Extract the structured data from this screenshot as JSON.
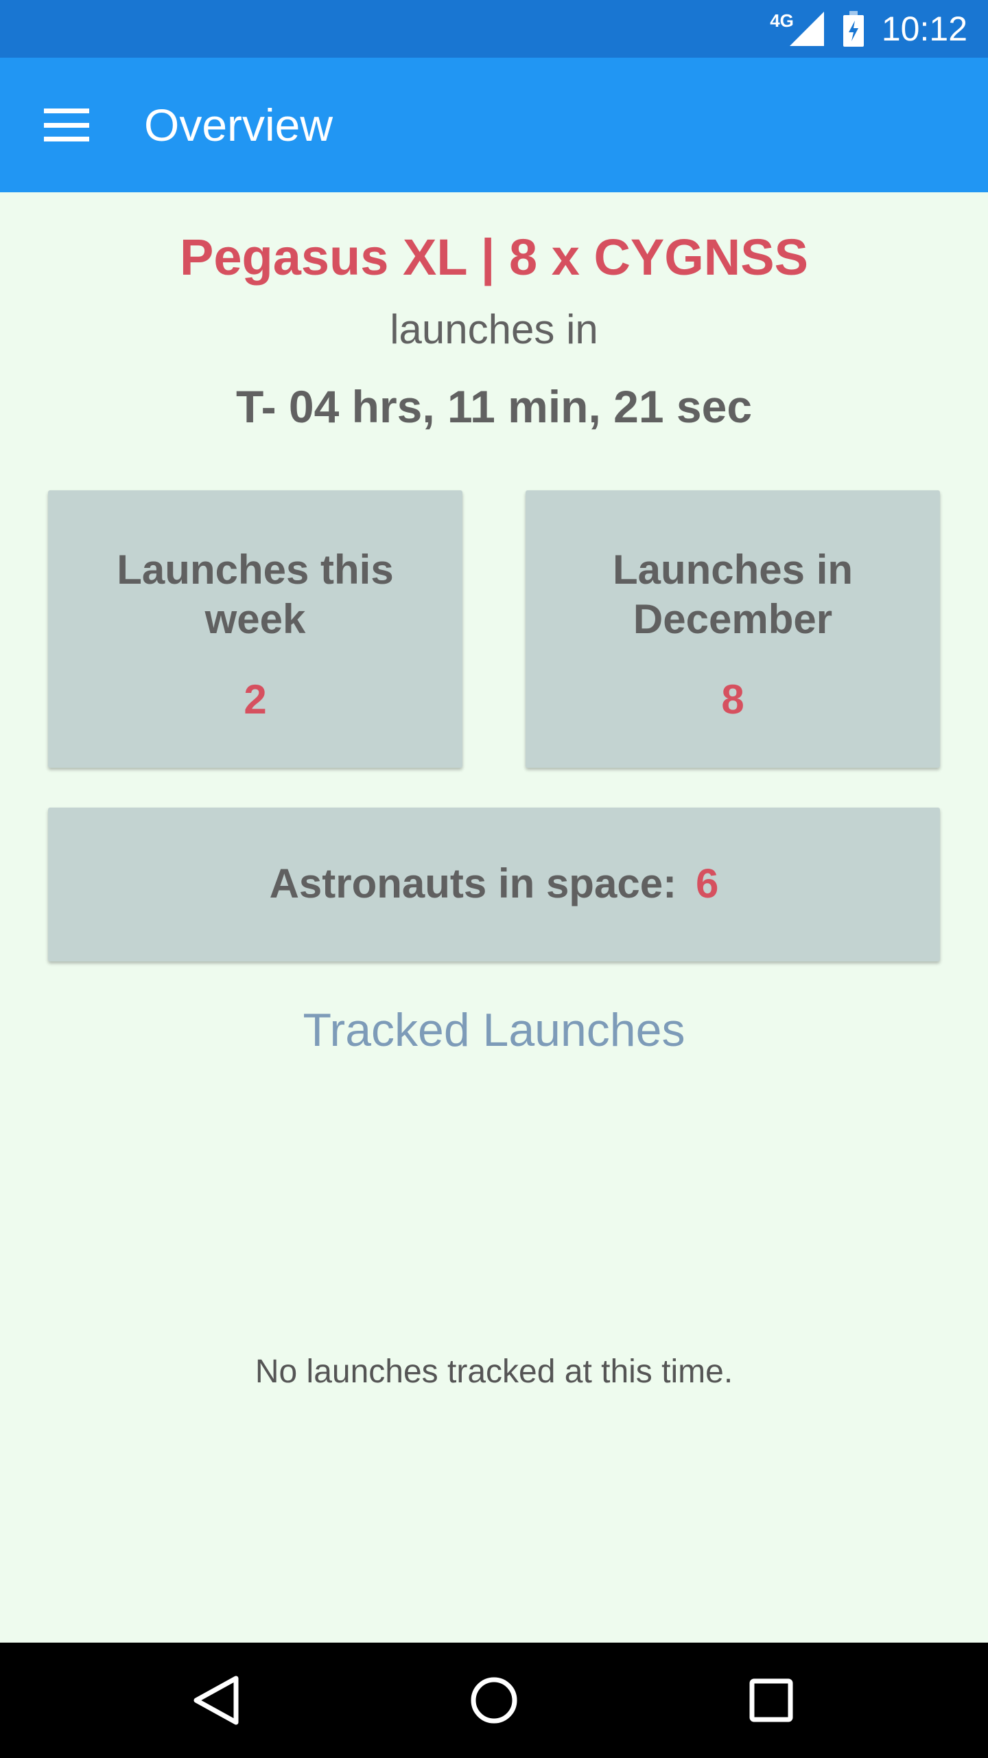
{
  "status_bar": {
    "network": "4G",
    "time": "10:12"
  },
  "app_bar": {
    "title": "Overview",
    "menu_icon": "hamburger-menu-icon"
  },
  "next_launch": {
    "name": "Pegasus XL | 8 x CYGNSS",
    "subtitle": "launches in",
    "countdown": "T- 04 hrs, 11 min, 21 sec"
  },
  "stats": {
    "week": {
      "label": "Launches this week",
      "value": "2"
    },
    "month": {
      "label": "Launches in December",
      "value": "8"
    },
    "astronauts": {
      "label": "Astronauts in space:",
      "value": "6"
    }
  },
  "tracked": {
    "title": "Tracked Launches",
    "empty_message": "No launches tracked at this time."
  },
  "nav_bar": {
    "buttons": [
      "back-icon",
      "home-icon",
      "recents-icon"
    ]
  },
  "colors": {
    "status_bar": "#1976d2",
    "app_bar": "#2196f3",
    "background": "#eefbee",
    "accent": "#d6505f",
    "card": "#c3d3d1",
    "tracked_title": "#7d9bb8"
  }
}
